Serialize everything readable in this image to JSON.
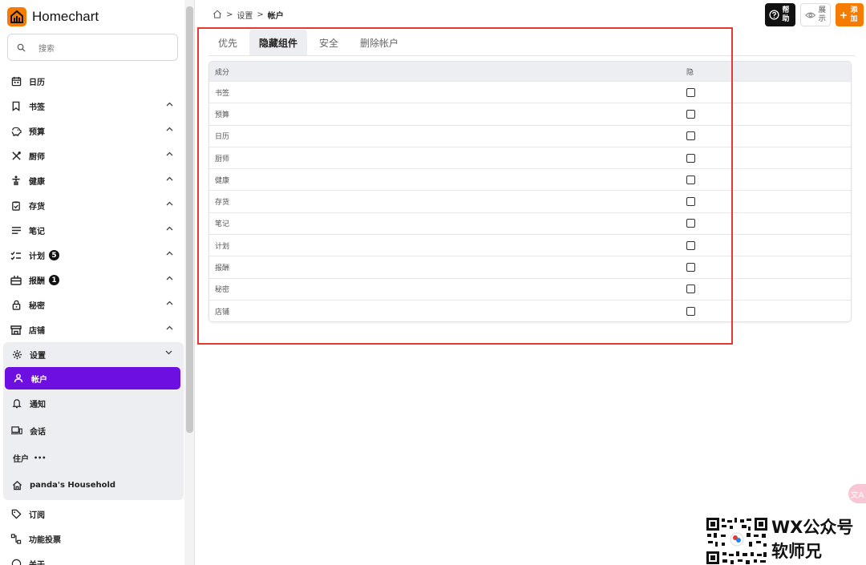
{
  "app": {
    "name": "Homechart"
  },
  "search": {
    "placeholder": "搜索"
  },
  "sidebar": {
    "items": [
      {
        "label": "日历"
      },
      {
        "label": "书签"
      },
      {
        "label": "预算"
      },
      {
        "label": "厨师"
      },
      {
        "label": "健康"
      },
      {
        "label": "存货"
      },
      {
        "label": "笔记"
      },
      {
        "label": "计划",
        "badge": "5"
      },
      {
        "label": "报酬",
        "badge": "1"
      },
      {
        "label": "秘密"
      },
      {
        "label": "店铺"
      }
    ],
    "settings": {
      "label": "设置",
      "children": [
        {
          "label": "帐户"
        },
        {
          "label": "通知"
        },
        {
          "label": "会话"
        }
      ],
      "household_label": "住户",
      "household_more": "•••",
      "household_name": "panda's Household"
    },
    "bottom": [
      {
        "label": "订阅"
      },
      {
        "label": "功能投票"
      },
      {
        "label": "关于"
      }
    ]
  },
  "breadcrumb": {
    "sep": ">",
    "settings": "设置",
    "current": "帐户"
  },
  "toolbar": {
    "help": "帮助",
    "view": "展示",
    "add": "添加"
  },
  "tabs": [
    {
      "label": "优先"
    },
    {
      "label": "隐藏组件",
      "selected": true
    },
    {
      "label": "安全"
    },
    {
      "label": "删除帐户"
    }
  ],
  "table": {
    "headers": {
      "component": "成分",
      "hide": "隐"
    },
    "rows": [
      "书签",
      "预算",
      "日历",
      "厨师",
      "健康",
      "存货",
      "笔记",
      "计划",
      "报酬",
      "秘密",
      "店铺"
    ]
  },
  "watermark": {
    "line1": "WX公众号",
    "line2": "软师兄"
  },
  "floating": {
    "label": "文A"
  },
  "colors": {
    "brand": "#f57c00",
    "active": "#6d0fe0",
    "highlight": "#e53935"
  }
}
